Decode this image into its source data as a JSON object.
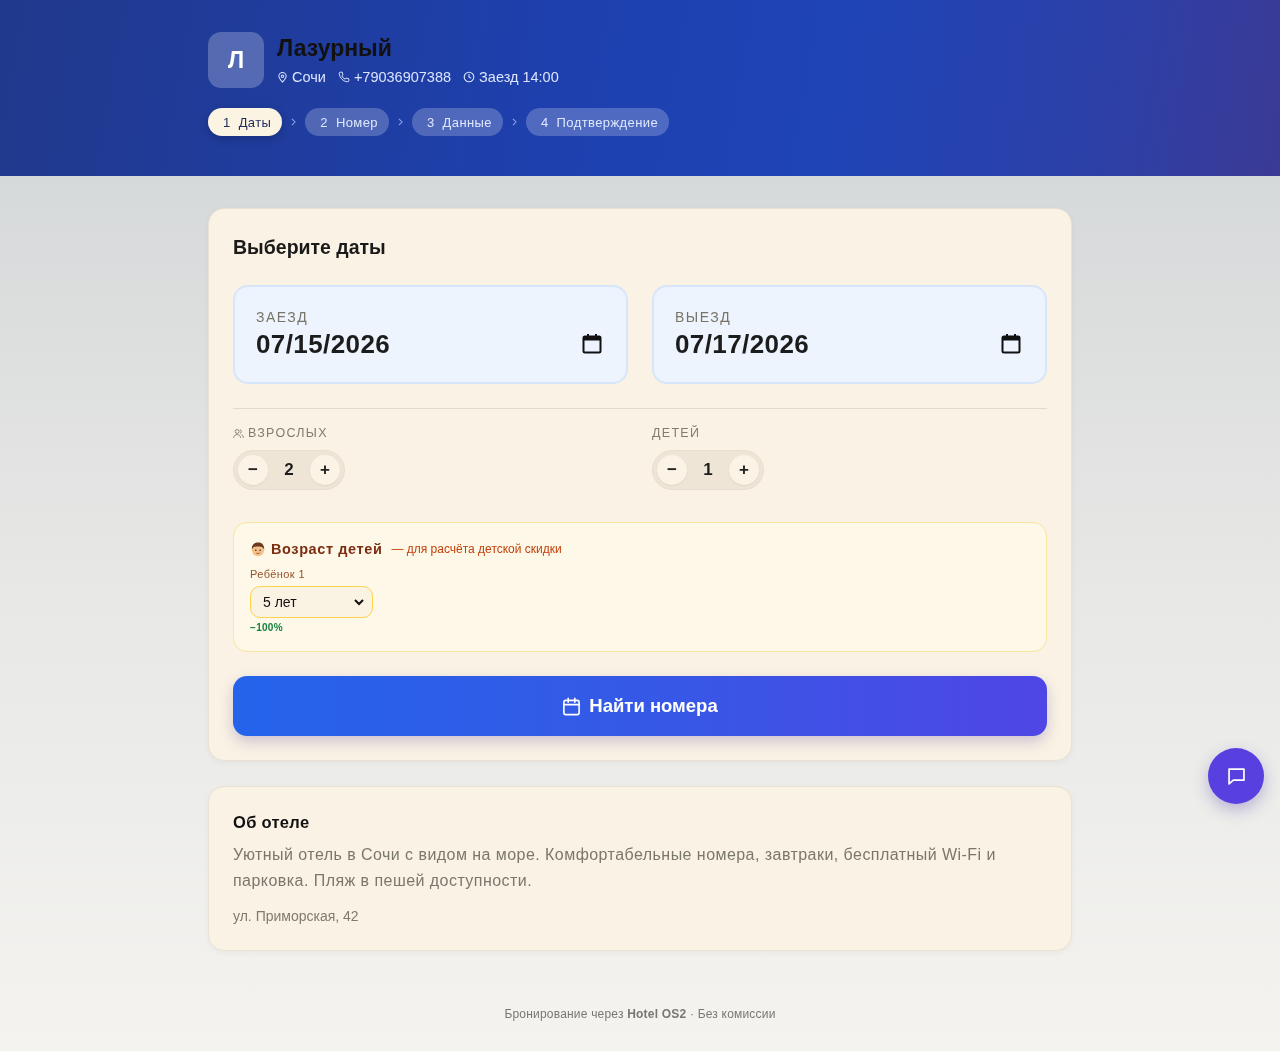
{
  "header": {
    "logo_letter": "Л",
    "title": "Лазурный",
    "meta": [
      {
        "kind": "location",
        "text": "Сочи"
      },
      {
        "kind": "phone",
        "text": "+79036907388"
      },
      {
        "kind": "clock",
        "text": "Заезд 14:00"
      }
    ]
  },
  "steps": [
    {
      "number": "1",
      "label": "Даты",
      "selected": true
    },
    {
      "number": "2",
      "label": "Номер",
      "selected": false
    },
    {
      "number": "3",
      "label": "Данные",
      "selected": false
    },
    {
      "number": "4",
      "label": "Подтверждение",
      "selected": false
    }
  ],
  "booking": {
    "title": "Выберите даты",
    "dates": [
      {
        "label": "ЗАЕЗД",
        "value": "07/15/2026"
      },
      {
        "label": "ВЫЕЗД",
        "value": "07/17/2026"
      }
    ],
    "guests": [
      {
        "kind": "adults",
        "label": "ВЗРОСЛЫХ",
        "decrease": "−",
        "value": "2",
        "increase": "+"
      },
      {
        "kind": "children",
        "label": "ДЕТЕЙ",
        "decrease": "−",
        "value": "1",
        "increase": "+"
      }
    ],
    "children_ages": {
      "title": "Возраст детей",
      "subtitle": "— для расчёта детской скидки",
      "children": [
        {
          "label": "Ребёнок 1",
          "value": "5 лет",
          "discount": "−100%"
        }
      ]
    },
    "search_button": "Найти номера"
  },
  "about": {
    "title": "Об отеле",
    "description": "Уютный отель в Сочи с видом на море. Комфортабельные номера, завтраки, бесплатный Wi-Fi и парковка. Пляж в пешей доступности.",
    "address": "ул. Приморская, 42"
  },
  "footer": {
    "text": "Бронирование через **Hotel OS2** · Без комиссии"
  }
}
